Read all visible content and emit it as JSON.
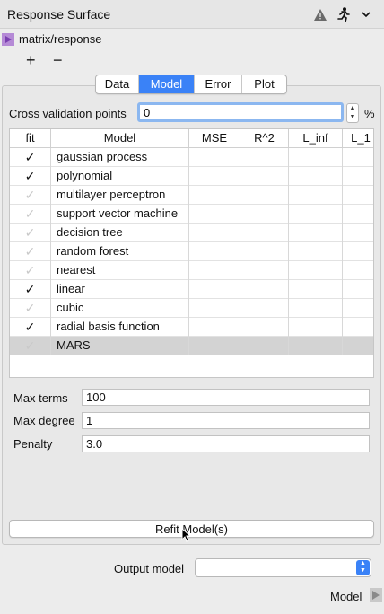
{
  "window": {
    "title": "Response Surface",
    "icons": [
      "warning-icon",
      "run-icon",
      "chevron-down-icon"
    ]
  },
  "node": {
    "path": "matrix/response",
    "add_label": "+",
    "remove_label": "−"
  },
  "tabs": [
    {
      "label": "Data",
      "active": false
    },
    {
      "label": "Model",
      "active": true
    },
    {
      "label": "Error",
      "active": false
    },
    {
      "label": "Plot",
      "active": false
    }
  ],
  "cross_validation": {
    "label": "Cross validation points",
    "value": "0",
    "unit": "%"
  },
  "table": {
    "headers": [
      "fit",
      "Model",
      "MSE",
      "R^2",
      "L_inf",
      "L_1"
    ],
    "rows": [
      {
        "fit": true,
        "name": "gaussian process"
      },
      {
        "fit": true,
        "name": "polynomial"
      },
      {
        "fit": false,
        "name": "multilayer perceptron"
      },
      {
        "fit": false,
        "name": "support vector machine"
      },
      {
        "fit": false,
        "name": "decision tree"
      },
      {
        "fit": false,
        "name": "random forest"
      },
      {
        "fit": false,
        "name": "nearest"
      },
      {
        "fit": true,
        "name": "linear"
      },
      {
        "fit": false,
        "name": "cubic"
      },
      {
        "fit": true,
        "name": "radial basis function"
      },
      {
        "fit": false,
        "name": "MARS",
        "selected": true
      }
    ],
    "check_glyph": "✓"
  },
  "params": [
    {
      "label": "Max terms",
      "value": "100"
    },
    {
      "label": "Max degree",
      "value": "1"
    },
    {
      "label": "Penalty",
      "value": "3.0"
    }
  ],
  "refit_button": "Refit Model(s)",
  "output": {
    "label": "Output model",
    "value": ""
  },
  "footer": {
    "label": "Model"
  },
  "colors": {
    "accent": "#3a82f7",
    "node_marker": "#b58ad6",
    "selected_row": "#d3d3d3"
  }
}
